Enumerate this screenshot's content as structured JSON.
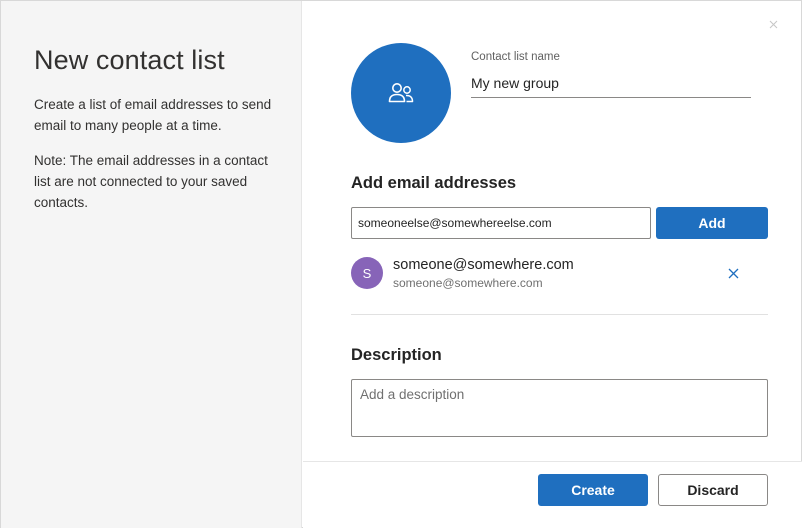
{
  "left_pane": {
    "title": "New contact list",
    "description": "Create a list of email addresses to send email to many people at a time.",
    "note": "Note: The email addresses in a contact list are not connected to your saved contacts."
  },
  "header": {
    "close_icon": "close-icon",
    "group_icon": "people-group-icon"
  },
  "contact_list_name": {
    "label": "Contact list name",
    "value": "My new group"
  },
  "add_emails": {
    "heading": "Add email addresses",
    "input_value": "someoneelse@somewhereelse.com",
    "add_label": "Add",
    "members": [
      {
        "initial": "S",
        "name": "someone@somewhere.com",
        "email": "someone@somewhere.com",
        "remove_icon": "close-icon"
      }
    ]
  },
  "description": {
    "heading": "Description",
    "placeholder": "Add a description",
    "value": ""
  },
  "footer": {
    "create_label": "Create",
    "discard_label": "Discard"
  },
  "colors": {
    "accent": "#1f6fbf",
    "member_avatar": "#8764b8",
    "left_pane_bg": "#f5f5f5"
  }
}
